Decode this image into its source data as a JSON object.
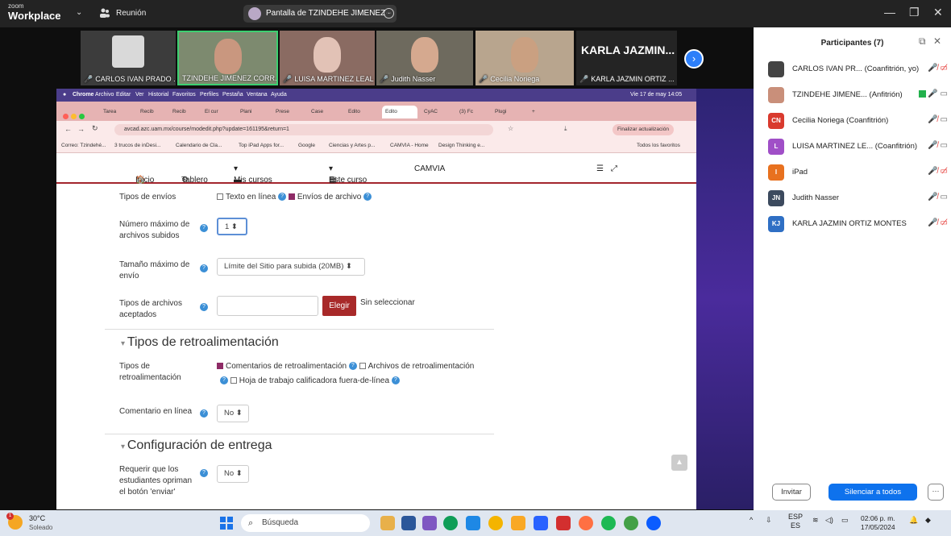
{
  "zoom": {
    "logo_small": "zoom",
    "logo_big": "Workplace",
    "meeting_label": "Reunión",
    "share_label": "Pantalla de TZINDEHE JIMENEZ ·"
  },
  "videos": [
    {
      "name": "CARLOS IVAN PRADO ..."
    },
    {
      "name": "TZINDEHE JIMENEZ CORR..."
    },
    {
      "name": "LUISA MARTINEZ LEAL"
    },
    {
      "name": "Judith Nasser"
    },
    {
      "name": "Cecilia Noriega"
    },
    {
      "name": "KARLA JAZMIN ORTIZ ...",
      "big": "KARLA JAZMIN..."
    }
  ],
  "screen": {
    "menubar": [
      "Chrome",
      "Archivo",
      "Editar",
      "Ver",
      "Historial",
      "Favoritos",
      "Perfiles",
      "Pestaña",
      "Ventana",
      "Ayuda"
    ],
    "menubar_right": "Vie 17 de may 14:05",
    "tabs": [
      "Tarea",
      "Recib",
      "Recib",
      "El cur",
      "Plani",
      "Prese",
      "Case",
      "Edito",
      "Edito",
      "CyAC",
      "(3) Fc",
      "Plugi"
    ],
    "url": "avcad.azc.uam.mx/course/modedit.php?update=161195&return=1",
    "finalizar": "Finalizar actualización",
    "bookmarks": [
      "Correo: Tzindehé...",
      "3 trucos de inDesi...",
      "Calendario de Cla...",
      "Top iPad Apps for...",
      "Google",
      "Ciencias y Artes p...",
      "CAMVIA - Home",
      "Design Thinking e...",
      "Todos los favoritos"
    ],
    "nav": {
      "inicio": "Inicio",
      "tablero": "Tablero",
      "mis_cursos": "Mis cursos",
      "este_curso": "Este curso",
      "camvia": "CAMVIA"
    },
    "form": {
      "tipos_envios_label": "Tipos de envíos",
      "texto_en_linea": "Texto en línea",
      "envios_archivo": "Envíos de archivo",
      "num_max_label_1": "Número máximo de",
      "num_max_label_2": "archivos subidos",
      "num_max_value": "1",
      "tam_max_label_1": "Tamaño máximo de",
      "tam_max_label_2": "envío",
      "tam_max_value": "Límite del Sitio para subida (20MB)",
      "tipos_arch_label_1": "Tipos de archivos",
      "tipos_arch_label_2": "aceptados",
      "elegir": "Elegir",
      "sin_seleccionar": "Sin seleccionar",
      "section_retro": "Tipos de retroalimentación",
      "tipos_retro_label_1": "Tipos de",
      "tipos_retro_label_2": "retroalimentación",
      "comentarios_retro": "Comentarios de retroalimentación",
      "archivos_retro": "Archivos de retroalimentación",
      "hoja_trabajo": "Hoja de trabajo calificadora fuera-de-línea",
      "comentario_linea_label": "Comentario en línea",
      "comentario_linea_value": "No",
      "section_config": "Configuración de entrega",
      "requerir_1": "Requerir que los",
      "requerir_2": "estudiantes opriman",
      "requerir_3": "el botón 'enviar'",
      "requerir_value": "No"
    }
  },
  "participants": {
    "title": "Participantes (7)",
    "list": [
      {
        "initials": "",
        "name": "CARLOS IVAN PR... (Coanfitrión, yo)",
        "color": "#444444"
      },
      {
        "initials": "",
        "name": "TZINDEHE JIMENE... (Anfitrión)",
        "color": "#c98f7a"
      },
      {
        "initials": "CN",
        "name": "Cecilia Noriega (Coanfitrión)",
        "color": "#d93a2e"
      },
      {
        "initials": "L",
        "name": "LUISA MARTINEZ LE... (Coanfitrión)",
        "color": "#a04fc7"
      },
      {
        "initials": "I",
        "name": "iPad",
        "color": "#e8711f"
      },
      {
        "initials": "JN",
        "name": "Judith Nasser",
        "color": "#3c4a5e"
      },
      {
        "initials": "KJ",
        "name": "KARLA JAZMIN ORTIZ MONTES",
        "color": "#2f6fc4"
      }
    ],
    "invitar": "Invitar",
    "silenciar": "Silenciar a todos",
    "more": "···"
  },
  "taskbar": {
    "temp": "30°C",
    "condition": "Soleado",
    "badge": "1",
    "search": "Búsqueda",
    "lang_1": "ESP",
    "lang_2": "ES",
    "time": "02:06 p. m.",
    "date": "17/05/2024"
  }
}
